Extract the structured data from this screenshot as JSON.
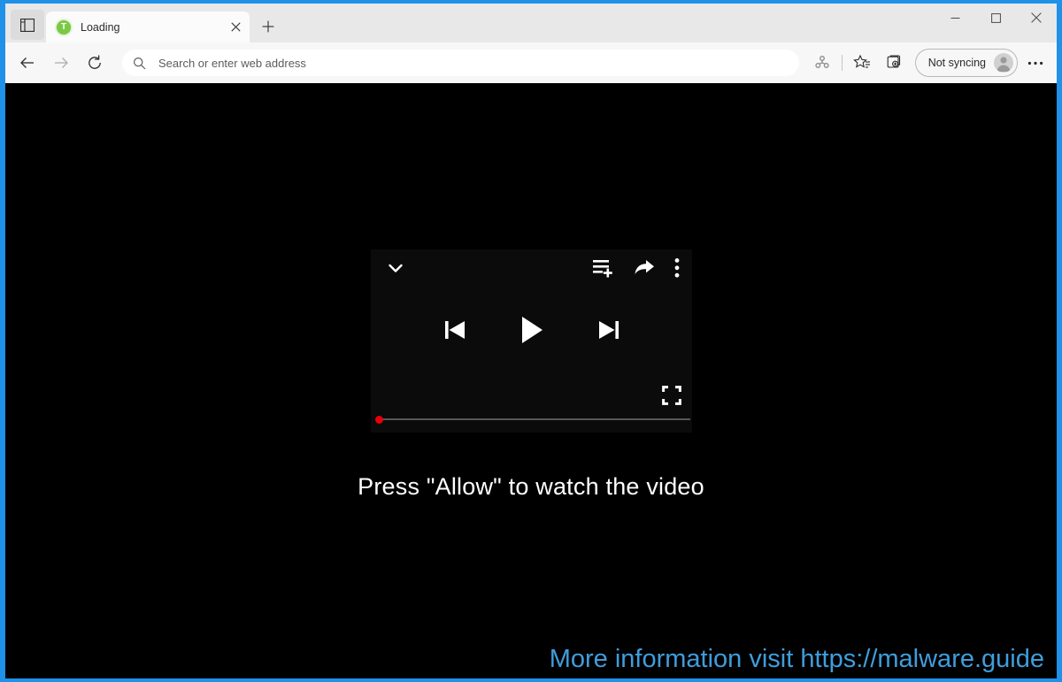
{
  "window": {
    "controls": {
      "minimize_label": "Minimize",
      "maximize_label": "Maximize",
      "close_label": "Close"
    }
  },
  "tab_strip": {
    "tab_actions_label": "Tab actions menu",
    "new_tab_label": "New tab",
    "tabs": [
      {
        "title": "Loading",
        "favicon_letter": "T",
        "favicon_color": "#7ac943",
        "close_label": "Close tab"
      }
    ]
  },
  "nav_bar": {
    "back_label": "Back",
    "forward_label": "Forward",
    "refresh_label": "Refresh",
    "address": {
      "value": "",
      "placeholder": "Search or enter web address",
      "search_icon": "search-icon"
    },
    "toolbar_icons": [
      {
        "name": "extensions-icon",
        "label": "Extensions"
      },
      {
        "name": "favorites-icon",
        "label": "Favorites"
      },
      {
        "name": "collections-icon",
        "label": "Collections"
      }
    ],
    "profile": {
      "label": "Not syncing",
      "avatar": "avatar-icon"
    },
    "more_label": "Settings and more"
  },
  "page": {
    "background_color": "#000000",
    "player": {
      "background_color": "#0b0b0b",
      "collapse_label": "Collapse",
      "add_to_queue_label": "Add to queue",
      "share_label": "Share",
      "more_label": "More options",
      "previous_label": "Previous",
      "play_label": "Play",
      "next_label": "Next",
      "fullscreen_label": "Fullscreen",
      "progress": {
        "percent": 0,
        "handle_color": "#e8000a",
        "track_color": "#575757"
      }
    },
    "allow_message": "Press \"Allow\" to watch the video",
    "watermark": {
      "text": "More information visit https://malware.guide",
      "color": "#3f9ddd"
    }
  },
  "desktop": {
    "background_color": "#1f91e8"
  }
}
